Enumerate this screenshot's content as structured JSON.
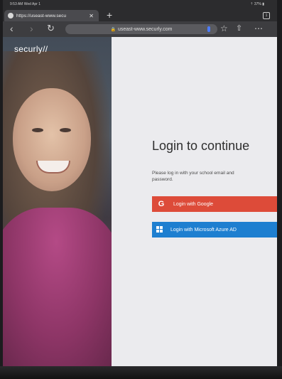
{
  "status_bar": {
    "time": "9:53 AM  Wed Apr 1",
    "battery": "⇡ 37% ▮"
  },
  "tabs": [
    {
      "title": "https://useast-www.secu",
      "close": "✕"
    }
  ],
  "new_tab_label": "+",
  "tab_count": "1",
  "toolbar": {
    "back": "‹",
    "forward": "›",
    "reload": "↻",
    "url": "useast-www.securly.com",
    "lock": "🔒",
    "bookmark": "☆",
    "share": "⇧",
    "menu": "⋯"
  },
  "brand": {
    "logo_text": "securly//"
  },
  "login": {
    "title": "Login to continue",
    "subtitle": "Please log in with your school email and password.",
    "google_label": "Login with Google",
    "google_icon": "G",
    "azure_label": "Login with Microsoft Azure AD"
  },
  "colors": {
    "google": "#dd4b39",
    "azure": "#1e7fd0"
  }
}
